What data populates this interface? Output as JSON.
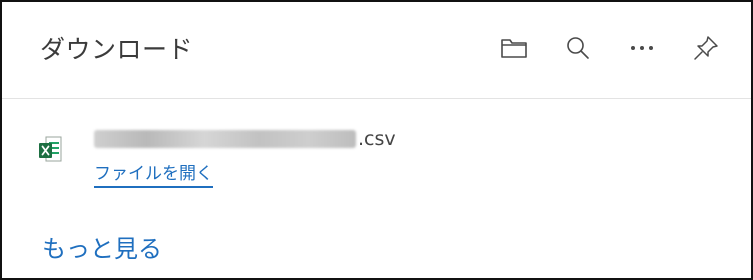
{
  "header": {
    "title": "ダウンロード"
  },
  "toolbar": {
    "icons": [
      "folder-icon",
      "search-icon",
      "more-options-icon",
      "pin-icon"
    ]
  },
  "downloads": [
    {
      "file_extension": ".csv",
      "file_icon": "excel-icon",
      "open_label": "ファイルを開く"
    }
  ],
  "footer": {
    "more_label": "もっと見る"
  },
  "colors": {
    "link": "#1f6fbf",
    "excel": "#1d6f42"
  }
}
